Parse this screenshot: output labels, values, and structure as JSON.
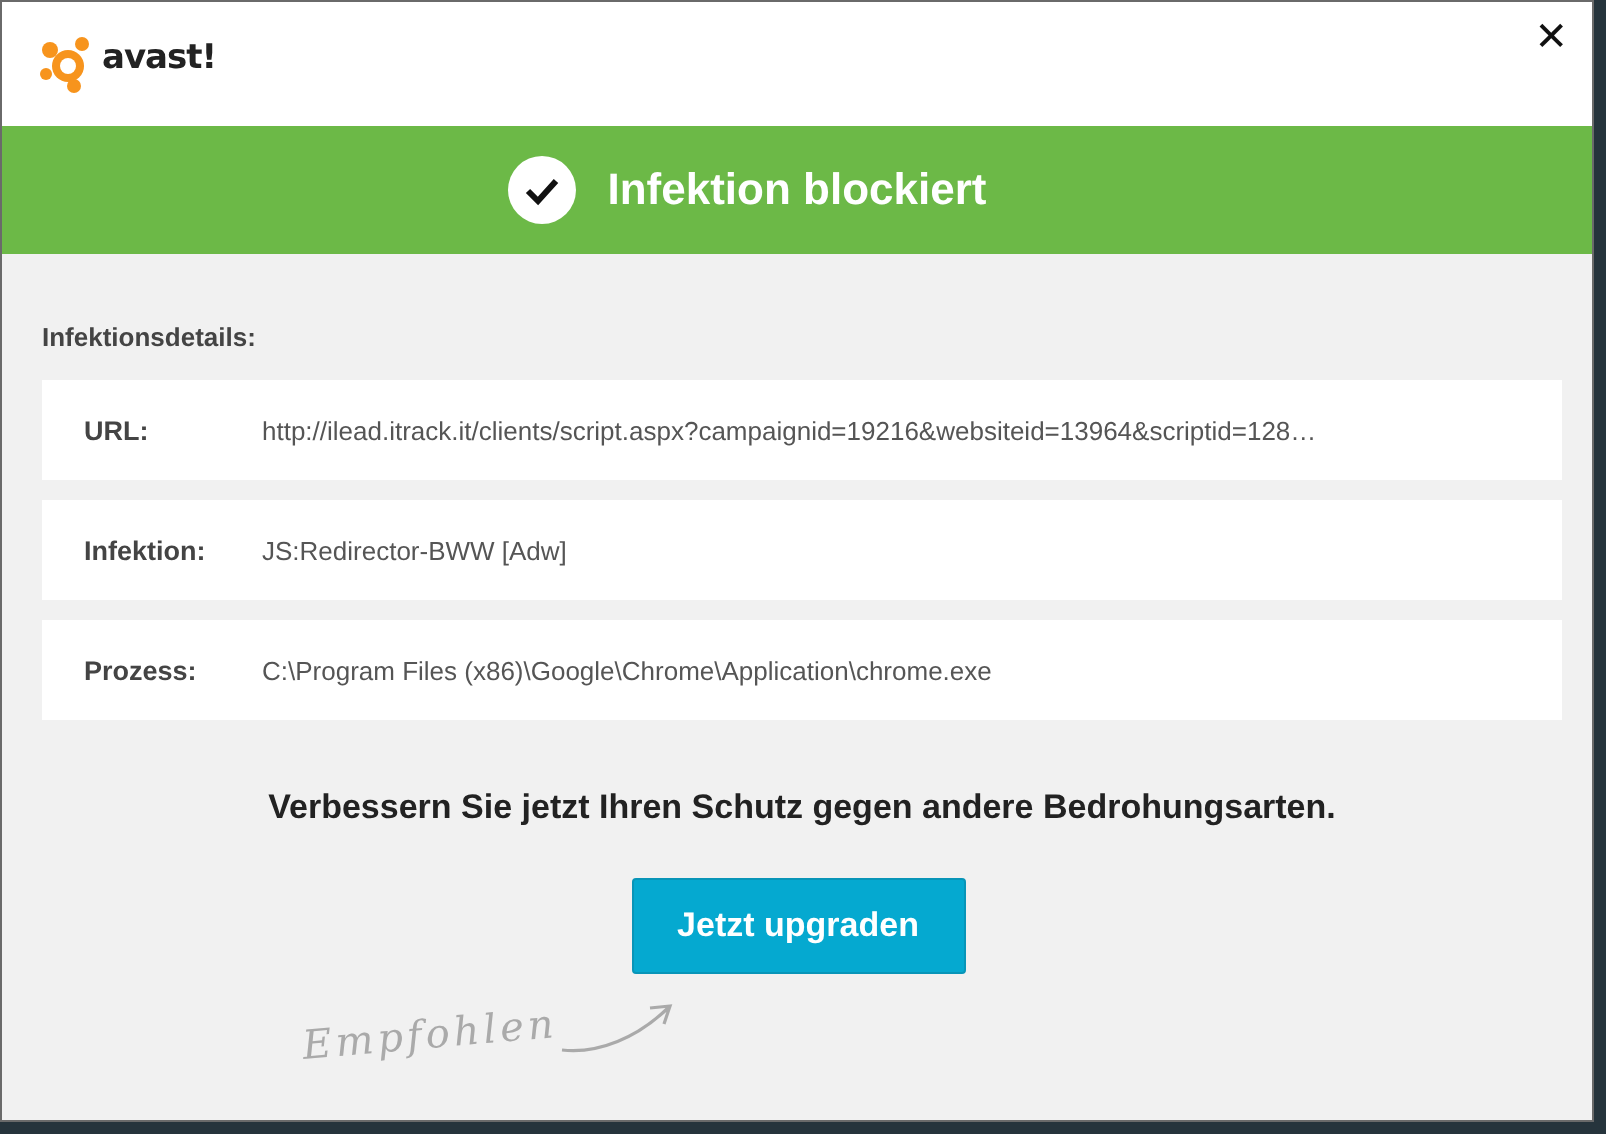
{
  "logo": {
    "text": "avast!"
  },
  "close": "✕",
  "banner": {
    "title": "Infektion blockiert"
  },
  "details": {
    "heading": "Infektionsdetails:",
    "rows": [
      {
        "label": "URL:",
        "value": "http://ilead.itrack.it/clients/script.aspx?campaignid=19216&websiteid=13964&scriptid=128…"
      },
      {
        "label": "Infektion:",
        "value": "JS:Redirector-BWW [Adw]"
      },
      {
        "label": "Prozess:",
        "value": "C:\\Program Files (x86)\\Google\\Chrome\\Application\\chrome.exe"
      }
    ]
  },
  "message": "Verbessern Sie jetzt Ihren Schutz gegen andere Bedrohungsarten.",
  "button": "Jetzt upgraden",
  "recommended": "Empfohlen"
}
